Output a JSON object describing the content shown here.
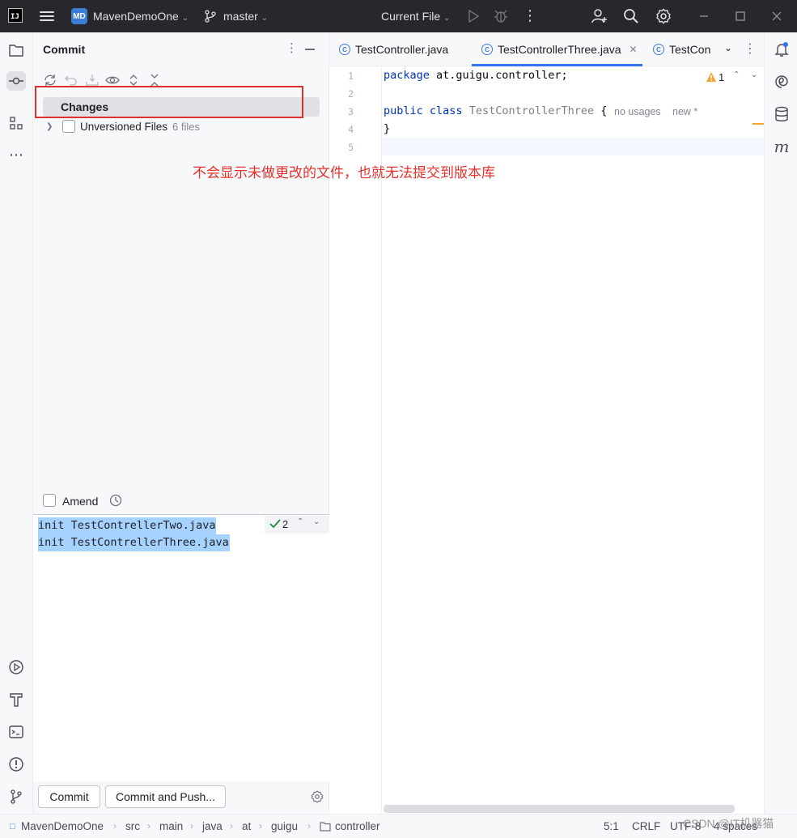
{
  "titlebar": {
    "logo_text": "IJ",
    "project_badge": "MD",
    "project_name": "MavenDemoOne",
    "branch": "master",
    "run_config": "Current File"
  },
  "commit_panel": {
    "title": "Commit",
    "changes_label": "Changes",
    "unversioned_label": "Unversioned Files",
    "unversioned_count": "6 files",
    "amend_label": "Amend",
    "message_lines": [
      "init TestContrellerTwo.java",
      "init TestContrellerThree.java"
    ],
    "message_badge_count": "2",
    "commit_button": "Commit",
    "commit_push_button": "Commit and Push..."
  },
  "annotation": "不会显示未做更改的文件，也就无法提交到版本库",
  "editor": {
    "tabs": [
      {
        "label": "TestController.java",
        "active": false
      },
      {
        "label": "TestControllerThree.java",
        "active": true
      },
      {
        "label": "TestCon",
        "active": false
      }
    ],
    "line_numbers": [
      "1",
      "2",
      "3",
      "4",
      "5"
    ],
    "line1_kw": "package",
    "line1_rest": " at.guigu.controller;",
    "line3_kw": "public class",
    "line3_name": "TestControllerThree",
    "line3_rest": " {",
    "line4": "}",
    "hint_usages": "no usages",
    "hint_new": "new *",
    "warning_count": "1"
  },
  "statusbar": {
    "breadcrumbs": [
      "MavenDemoOne",
      "src",
      "main",
      "java",
      "at",
      "guigu",
      "controller"
    ],
    "position": "5:1",
    "line_ending": "CRLF",
    "encoding": "UTF-8",
    "indent": "4 spaces"
  },
  "watermark": "CSDN @IT机器猫",
  "colors": {
    "titlebar_bg": "#27282c",
    "selection": "#a6d2ff",
    "annotation_red": "#e5302b",
    "accent": "#3574f0"
  }
}
